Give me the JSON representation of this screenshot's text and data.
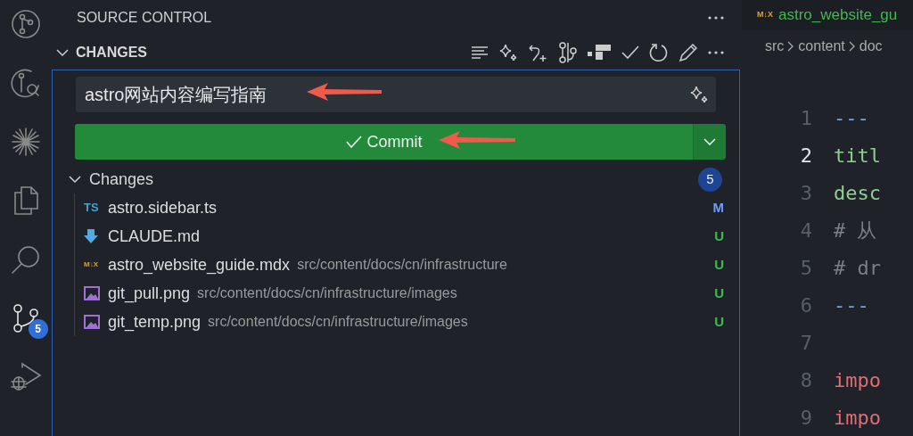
{
  "activity_bar": [
    {
      "kind": "source-graph",
      "selected": false
    },
    {
      "kind": "source-search",
      "selected": false
    },
    {
      "kind": "spark",
      "selected": false
    },
    {
      "kind": "explorer",
      "selected": false
    },
    {
      "kind": "search",
      "selected": false
    },
    {
      "kind": "scm",
      "selected": true,
      "badge": "5"
    },
    {
      "kind": "debug",
      "selected": false
    }
  ],
  "sidebar": {
    "title": "SOURCE CONTROL",
    "section": {
      "title": "CHANGES",
      "expanded": true
    },
    "commit_message": "astro网站内容编写指南",
    "commit_button": "Commit",
    "group": {
      "label": "Changes",
      "count": "5",
      "expanded": true,
      "files": [
        {
          "kind": "ts",
          "icon_text": "TS",
          "name": "astro.sidebar.ts",
          "status": "M",
          "color": "#6c9ef8"
        },
        {
          "kind": "md",
          "name": "CLAUDE.md",
          "status": "U",
          "color": "#3fb950"
        },
        {
          "kind": "mdx",
          "icon_text": "M↓X",
          "name": "astro_website_guide.mdx",
          "path": "src/content/docs/cn/infrastructure",
          "status": "U",
          "color": "#3fb950"
        },
        {
          "kind": "image",
          "name": "git_pull.png",
          "path": "src/content/docs/cn/infrastructure/images",
          "status": "U",
          "color": "#3fb950"
        },
        {
          "kind": "image",
          "name": "git_temp.png",
          "path": "src/content/docs/cn/infrastructure/images",
          "status": "U",
          "color": "#3fb950"
        }
      ]
    }
  },
  "editor": {
    "tab": {
      "icon_text": "M↓X",
      "title": "astro_website_gu"
    },
    "breadcrumb": [
      "src",
      "content",
      "doc"
    ],
    "lines": [
      {
        "number": "1",
        "kind": "separator",
        "text": "---",
        "current": false
      },
      {
        "number": "2",
        "kind": "key",
        "text": "titl",
        "current": true
      },
      {
        "number": "3",
        "kind": "key",
        "text": "desc",
        "current": false
      },
      {
        "number": "4",
        "kind": "comment",
        "text": "# 从",
        "current": false
      },
      {
        "number": "5",
        "kind": "comment",
        "text": "# dr",
        "current": false
      },
      {
        "number": "6",
        "kind": "separator",
        "text": "---",
        "current": false
      },
      {
        "number": "7",
        "current": false
      },
      {
        "number": "8",
        "kind": "keyword",
        "text": "impo",
        "current": false
      },
      {
        "number": "9",
        "kind": "keyword",
        "text": "impo",
        "current": false
      }
    ]
  }
}
